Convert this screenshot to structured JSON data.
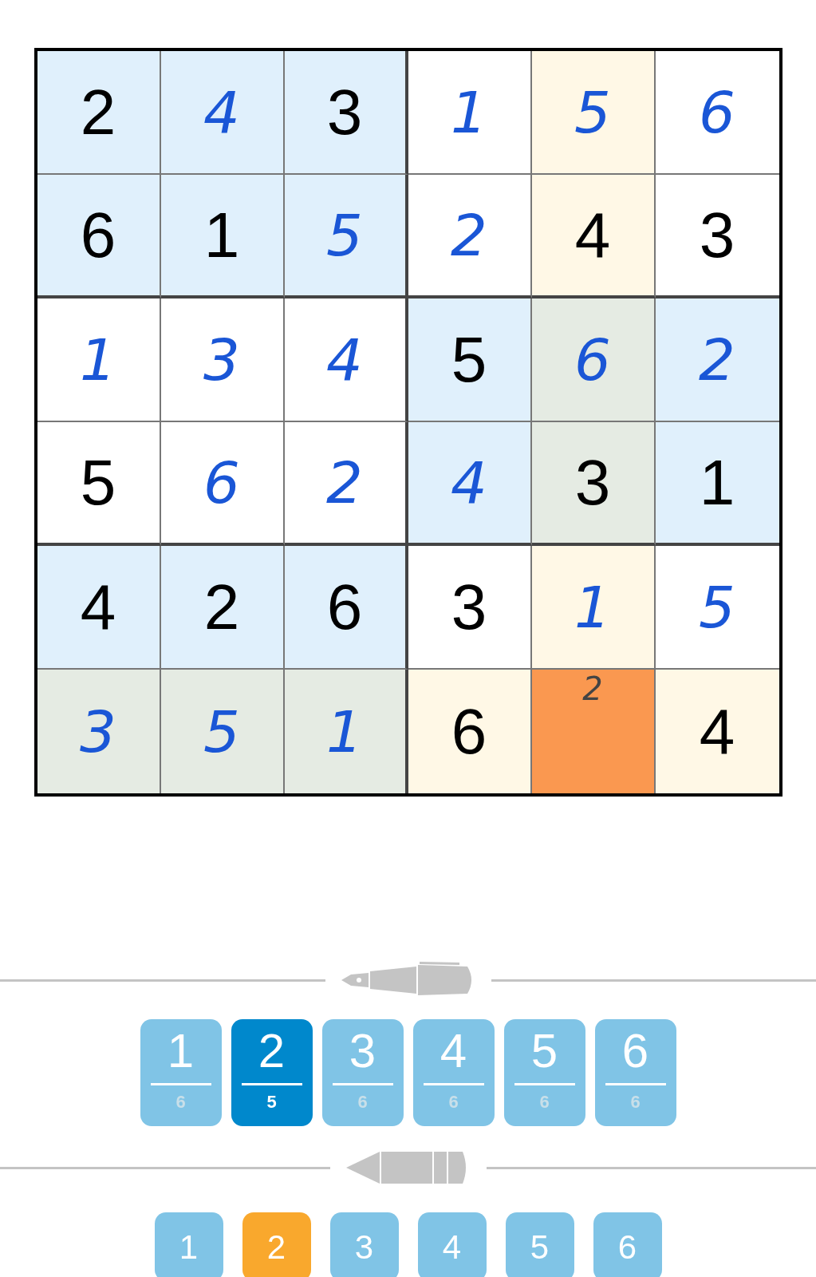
{
  "grid": {
    "rows": [
      [
        {
          "value": "2",
          "kind": "given",
          "color": "#e0f0fc"
        },
        {
          "value": "4",
          "kind": "entered",
          "color": "#e0f0fc"
        },
        {
          "value": "3",
          "kind": "given",
          "color": "#e0f0fc"
        },
        {
          "value": "1",
          "kind": "entered",
          "color": "#ffffff"
        },
        {
          "value": "5",
          "kind": "entered",
          "color": "#fff8e6"
        },
        {
          "value": "6",
          "kind": "entered",
          "color": "#ffffff"
        }
      ],
      [
        {
          "value": "6",
          "kind": "given",
          "color": "#e0f0fc"
        },
        {
          "value": "1",
          "kind": "given",
          "color": "#e0f0fc"
        },
        {
          "value": "5",
          "kind": "entered",
          "color": "#e0f0fc"
        },
        {
          "value": "2",
          "kind": "entered",
          "color": "#ffffff"
        },
        {
          "value": "4",
          "kind": "given",
          "color": "#fff8e6"
        },
        {
          "value": "3",
          "kind": "given",
          "color": "#ffffff"
        }
      ],
      [
        {
          "value": "1",
          "kind": "entered",
          "color": "#ffffff"
        },
        {
          "value": "3",
          "kind": "entered",
          "color": "#ffffff"
        },
        {
          "value": "4",
          "kind": "entered",
          "color": "#ffffff"
        },
        {
          "value": "5",
          "kind": "given",
          "color": "#e0f0fc"
        },
        {
          "value": "6",
          "kind": "entered",
          "color": "#e5ebe3"
        },
        {
          "value": "2",
          "kind": "entered",
          "color": "#e0f0fc"
        }
      ],
      [
        {
          "value": "5",
          "kind": "given",
          "color": "#ffffff"
        },
        {
          "value": "6",
          "kind": "entered",
          "color": "#ffffff"
        },
        {
          "value": "2",
          "kind": "entered",
          "color": "#ffffff"
        },
        {
          "value": "4",
          "kind": "entered",
          "color": "#e0f0fc"
        },
        {
          "value": "3",
          "kind": "given",
          "color": "#e5ebe3"
        },
        {
          "value": "1",
          "kind": "given",
          "color": "#e0f0fc"
        }
      ],
      [
        {
          "value": "4",
          "kind": "given",
          "color": "#e0f0fc"
        },
        {
          "value": "2",
          "kind": "given",
          "color": "#e0f0fc"
        },
        {
          "value": "6",
          "kind": "given",
          "color": "#e0f0fc"
        },
        {
          "value": "3",
          "kind": "given",
          "color": "#ffffff"
        },
        {
          "value": "1",
          "kind": "entered",
          "color": "#fff8e6"
        },
        {
          "value": "5",
          "kind": "entered",
          "color": "#ffffff"
        }
      ],
      [
        {
          "value": "3",
          "kind": "entered",
          "color": "#e5ebe3"
        },
        {
          "value": "5",
          "kind": "entered",
          "color": "#e5ebe3"
        },
        {
          "value": "1",
          "kind": "entered",
          "color": "#e5ebe3"
        },
        {
          "value": "6",
          "kind": "given",
          "color": "#fff8e6"
        },
        {
          "value": "2",
          "kind": "note",
          "color": "#fa9850"
        },
        {
          "value": "4",
          "kind": "given",
          "color": "#fff8e6"
        }
      ]
    ]
  },
  "pen_digits": [
    {
      "digit": "1",
      "count": "6",
      "selected": false
    },
    {
      "digit": "2",
      "count": "5",
      "selected": true
    },
    {
      "digit": "3",
      "count": "6",
      "selected": false
    },
    {
      "digit": "4",
      "count": "6",
      "selected": false
    },
    {
      "digit": "5",
      "count": "6",
      "selected": false
    },
    {
      "digit": "6",
      "count": "6",
      "selected": false
    }
  ],
  "pencil_digits": [
    {
      "digit": "1",
      "selected": false
    },
    {
      "digit": "2",
      "selected": true
    },
    {
      "digit": "3",
      "selected": false
    },
    {
      "digit": "4",
      "selected": false
    },
    {
      "digit": "5",
      "selected": false
    },
    {
      "digit": "6",
      "selected": false
    }
  ]
}
